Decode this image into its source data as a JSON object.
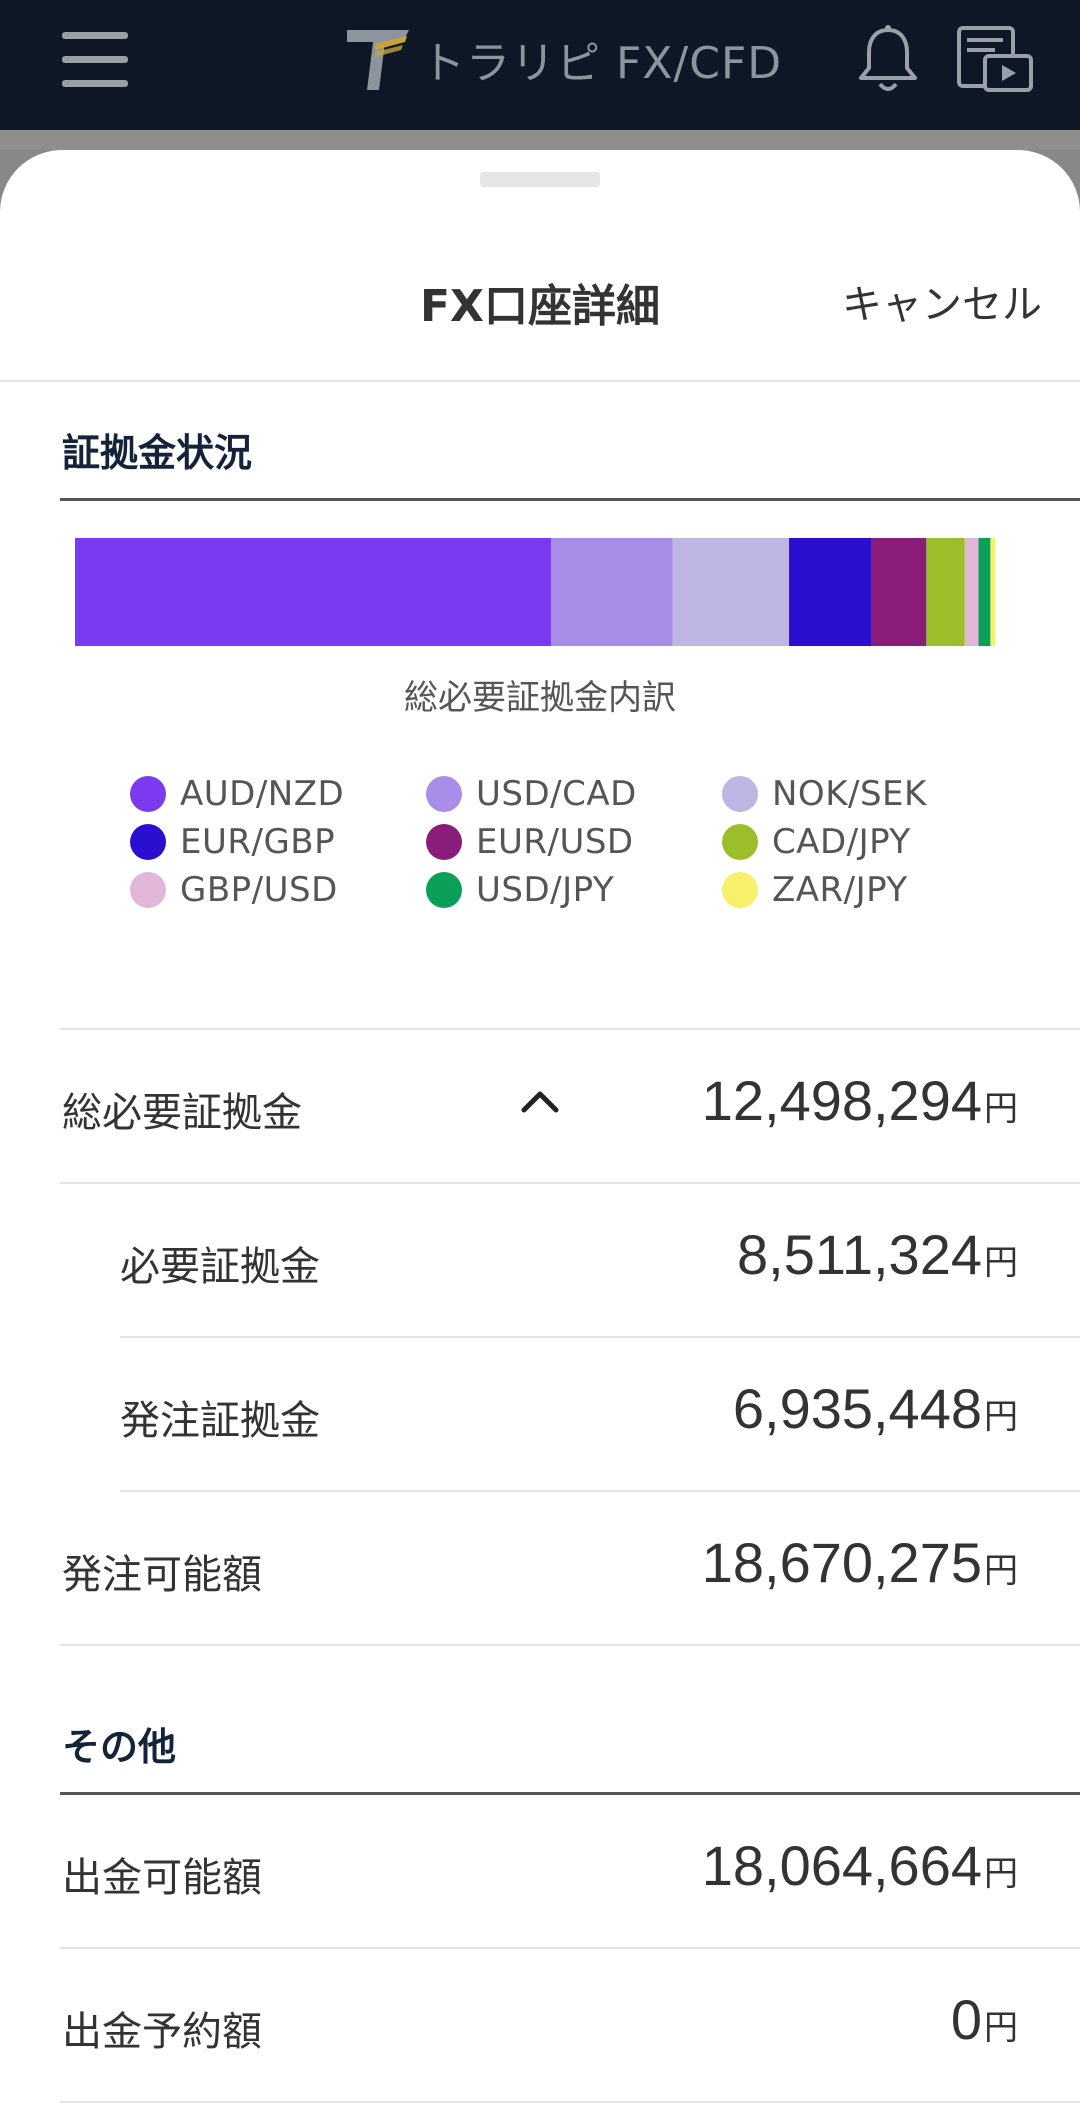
{
  "header": {
    "brand": "トラリピ FX/CFD",
    "menu_icon": "hamburger-menu-icon",
    "bell_icon": "bell-icon",
    "video_icon": "video-guide-icon"
  },
  "sheet": {
    "title": "FX口座詳細",
    "cancel_label": "キャンセル"
  },
  "margin_section": {
    "heading": "証拠金状況",
    "chart_caption": "総必要証拠金内訳"
  },
  "chart_data": {
    "type": "bar",
    "stacked": true,
    "orientation": "horizontal",
    "categories": [
      "AUD/NZD",
      "USD/CAD",
      "NOK/SEK",
      "EUR/GBP",
      "EUR/USD",
      "CAD/JPY",
      "GBP/USD",
      "USD/JPY",
      "ZAR/JPY"
    ],
    "values": [
      52.0,
      13.3,
      12.7,
      9.0,
      6.0,
      4.2,
      1.5,
      1.3,
      0.5
    ],
    "unit": "%",
    "colors": [
      "#7b3aef",
      "#a98de8",
      "#bfb5e3",
      "#2a0fd0",
      "#8a1c7a",
      "#9cbe2b",
      "#e2b6d6",
      "#0aa05a",
      "#f7f06a"
    ]
  },
  "legend": [
    {
      "label": "AUD/NZD",
      "color": "#7b3aef"
    },
    {
      "label": "USD/CAD",
      "color": "#a98de8"
    },
    {
      "label": "NOK/SEK",
      "color": "#bfb5e3"
    },
    {
      "label": "EUR/GBP",
      "color": "#2a0fd0"
    },
    {
      "label": "EUR/USD",
      "color": "#8a1c7a"
    },
    {
      "label": "CAD/JPY",
      "color": "#9cbe2b"
    },
    {
      "label": "GBP/USD",
      "color": "#e2b6d6"
    },
    {
      "label": "USD/JPY",
      "color": "#0aa05a"
    },
    {
      "label": "ZAR/JPY",
      "color": "#f7f06a"
    }
  ],
  "rows": {
    "total_required": {
      "label": "総必要証拠金",
      "value": "12,498,294",
      "unit": "円"
    },
    "required": {
      "label": "必要証拠金",
      "value": "8,511,324",
      "unit": "円"
    },
    "order_margin": {
      "label": "発注証拠金",
      "value": "6,935,448",
      "unit": "円"
    },
    "orderable": {
      "label": "発注可能額",
      "value": "18,670,275",
      "unit": "円"
    }
  },
  "other_section": {
    "heading": "その他",
    "withdrawable": {
      "label": "出金可能額",
      "value": "18,064,664",
      "unit": "円"
    },
    "withdraw_reserved": {
      "label": "出金予約額",
      "value": "0",
      "unit": "円"
    }
  }
}
